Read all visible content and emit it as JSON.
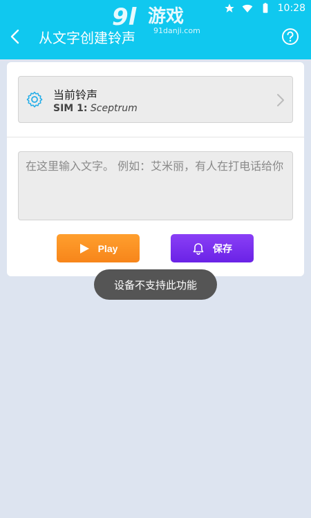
{
  "status_bar": {
    "time": "10:28",
    "icons": [
      "star-icon",
      "wifi-icon",
      "battery-icon"
    ]
  },
  "app_bar": {
    "title": "从文字创建铃声",
    "back_icon": "back-arrow-icon",
    "help_icon": "help-circle-icon",
    "color": "#10c8ef"
  },
  "watermark": {
    "logo_text": "9l游戏",
    "url": "91danji.com"
  },
  "current_ringtone": {
    "label": "当前铃声",
    "sim_label": "SIM 1:",
    "ringtone_name": "Sceptrum"
  },
  "text_input": {
    "placeholder": "在这里输入文字。 例如：艾米丽，有人在打电话给你",
    "value": ""
  },
  "buttons": {
    "play_label": "Play",
    "save_label": "保存",
    "play_color": "#f7851a",
    "save_color": "#6a22e6"
  },
  "toast": {
    "message": "设备不支持此功能"
  }
}
